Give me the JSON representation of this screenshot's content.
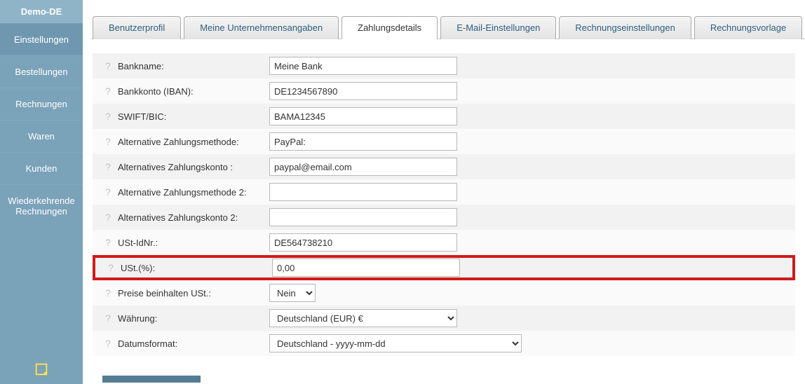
{
  "brand": "Demo-DE",
  "sidebar": [
    "Einstellungen",
    "Bestellungen",
    "Rechnungen",
    "Waren",
    "Kunden",
    "Wiederkehrende Rechnungen"
  ],
  "tabs": [
    "Benutzerprofil",
    "Meine Unternehmensangaben",
    "Zahlungsdetails",
    "E-Mail-Einstellungen",
    "Rechnungseinstellungen",
    "Rechnungsvorlage"
  ],
  "activeTab": 2,
  "activeNav": 0,
  "fields": {
    "bankname": {
      "label": "Bankname:",
      "value": "Meine Bank"
    },
    "iban": {
      "label": "Bankkonto (IBAN):",
      "value": "DE1234567890"
    },
    "swift": {
      "label": "SWIFT/BIC:",
      "value": "BAMA12345"
    },
    "altpay1": {
      "label": "Alternative Zahlungsmethode:",
      "value": "PayPal:"
    },
    "altacc1": {
      "label": "Alternatives Zahlungskonto :",
      "value": "paypal@email.com"
    },
    "altpay2": {
      "label": "Alternative Zahlungsmethode 2:",
      "value": ""
    },
    "altacc2": {
      "label": "Alternatives Zahlungskonto 2:",
      "value": ""
    },
    "ustid": {
      "label": "USt-IdNr.:",
      "value": "DE564738210"
    },
    "ustpct": {
      "label": "USt.(%):",
      "value": "0,00"
    },
    "incvat": {
      "label": "Preise beinhalten USt.:",
      "value": "Nein"
    },
    "currency": {
      "label": "Währung:",
      "value": "Deutschland (EUR) €"
    },
    "dateformat": {
      "label": "Datumsformat:",
      "value": "Deutschland - yyyy-mm-dd"
    }
  }
}
